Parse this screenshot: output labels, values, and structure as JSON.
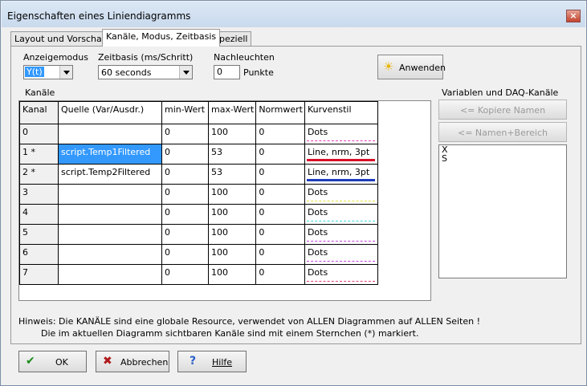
{
  "window": {
    "title": "Eigenschaften eines Liniendiagramms",
    "close_glyph": "×"
  },
  "tabs": [
    {
      "label": "Layout und Vorschau",
      "active": false
    },
    {
      "label": "Kanäle, Modus, Zeitbasis",
      "active": true
    },
    {
      "label": "Speziell",
      "active": false
    }
  ],
  "settings": {
    "mode_label": "Anzeigemodus",
    "mode_value": "Y(t)",
    "timebase_label": "Zeitbasis (ms/Schritt)",
    "timebase_value": "60 seconds",
    "afterglow_label": "Nachleuchten",
    "afterglow_value": "0",
    "afterglow_unit": "Punkte"
  },
  "apply_button": {
    "label": "Anwenden",
    "icon": "sun-icon"
  },
  "channels_label": "Kanäle",
  "table": {
    "headers": [
      "Kanal",
      "Quelle (Var/Ausdr.)",
      "min-Wert",
      "max-Wert",
      "Normwert",
      "Kurvenstil"
    ],
    "rows": [
      {
        "kanal": "0",
        "quelle": "",
        "min": "0",
        "max": "100",
        "norm": "0",
        "stil": "Dots",
        "color": "#e43cb8",
        "line": "dashed",
        "selected": false
      },
      {
        "kanal": "1 *",
        "quelle": "script.Temp1Filtered",
        "min": "0",
        "max": "53",
        "norm": "0",
        "stil": "Line, nrm, 3pt",
        "color": "#d8102a",
        "line": "solid",
        "selected": true
      },
      {
        "kanal": "2 *",
        "quelle": "script.Temp2Filtered",
        "min": "0",
        "max": "53",
        "norm": "0",
        "stil": "Line, nrm, 3pt",
        "color": "#1e3dbb",
        "line": "solid",
        "selected": false
      },
      {
        "kanal": "3",
        "quelle": "",
        "min": "0",
        "max": "100",
        "norm": "0",
        "stil": "Dots",
        "color": "#e8e040",
        "line": "dashed",
        "selected": false
      },
      {
        "kanal": "4",
        "quelle": "",
        "min": "0",
        "max": "100",
        "norm": "0",
        "stil": "Dots",
        "color": "#40d8d8",
        "line": "dashed",
        "selected": false
      },
      {
        "kanal": "5",
        "quelle": "",
        "min": "0",
        "max": "100",
        "norm": "0",
        "stil": "Dots",
        "color": "#c040d8",
        "line": "dashed",
        "selected": false
      },
      {
        "kanal": "6",
        "quelle": "",
        "min": "0",
        "max": "100",
        "norm": "0",
        "stil": "Dots",
        "color": "#c040d8",
        "line": "dashed",
        "selected": false
      },
      {
        "kanal": "7",
        "quelle": "",
        "min": "0",
        "max": "100",
        "norm": "0",
        "stil": "Dots",
        "color": "#e04070",
        "line": "dashed",
        "selected": false
      }
    ]
  },
  "variables": {
    "label": "Variablen und DAQ-Kanäle",
    "copy_names_button": "<= Kopiere Namen",
    "names_range_button": "<= Namen+Bereich",
    "items": [
      "X",
      "S"
    ]
  },
  "hint": {
    "line1": "Hinweis: Die KANÄLE sind eine globale Resource, verwendet von ALLEN Diagrammen auf ALLEN Seiten !",
    "line2": "Die im aktuellen Diagramm sichtbaren Kanäle sind mit einem Sternchen (*) markiert."
  },
  "buttons": {
    "ok": {
      "label": "OK",
      "icon": "checkmark-icon",
      "color": "#1a8a1a"
    },
    "cancel": {
      "label": "Abbrechen",
      "icon": "cross-icon",
      "color": "#b01818"
    },
    "help": {
      "label": "Hilfe",
      "icon": "question-icon",
      "color": "#2a60c8"
    }
  }
}
